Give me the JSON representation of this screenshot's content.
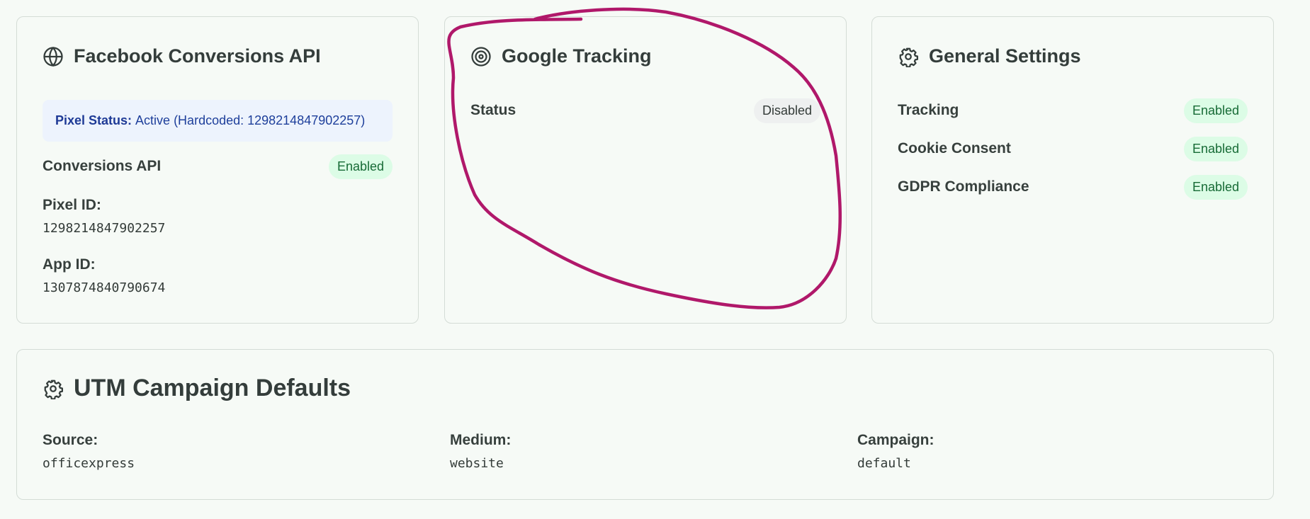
{
  "facebook": {
    "title": "Facebook Conversions API",
    "title_icon": "globe-icon",
    "pixel_status_label": "Pixel Status:",
    "pixel_status_value": "Active (Hardcoded: 1298214847902257)",
    "conversions_api_label": "Conversions API",
    "conversions_api_status": "Enabled",
    "pixel_id_label": "Pixel ID:",
    "pixel_id_value": "1298214847902257",
    "app_id_label": "App ID:",
    "app_id_value": "1307874840790674"
  },
  "google": {
    "title": "Google Tracking",
    "title_icon": "target-icon",
    "status_label": "Status",
    "status_value": "Disabled"
  },
  "general": {
    "title": "General Settings",
    "title_icon": "gear-icon",
    "rows": [
      {
        "label": "Tracking",
        "status": "Enabled"
      },
      {
        "label": "Cookie Consent",
        "status": "Enabled"
      },
      {
        "label": "GDPR Compliance",
        "status": "Enabled"
      }
    ]
  },
  "utm": {
    "title": "UTM Campaign Defaults",
    "title_icon": "gear-icon",
    "fields": [
      {
        "label": "Source:",
        "value": "officexpress"
      },
      {
        "label": "Medium:",
        "value": "website"
      },
      {
        "label": "Campaign:",
        "value": "default"
      }
    ]
  },
  "colors": {
    "background": "#f6faf6",
    "card_border": "#d4dcd6",
    "enabled_bg": "#dcfce6",
    "enabled_text": "#176b36",
    "disabled_bg": "#eef0f0",
    "pixel_box_bg": "#edf3fd",
    "pixel_box_text": "#1e3f9b",
    "annotation_stroke": "#b0186a"
  }
}
